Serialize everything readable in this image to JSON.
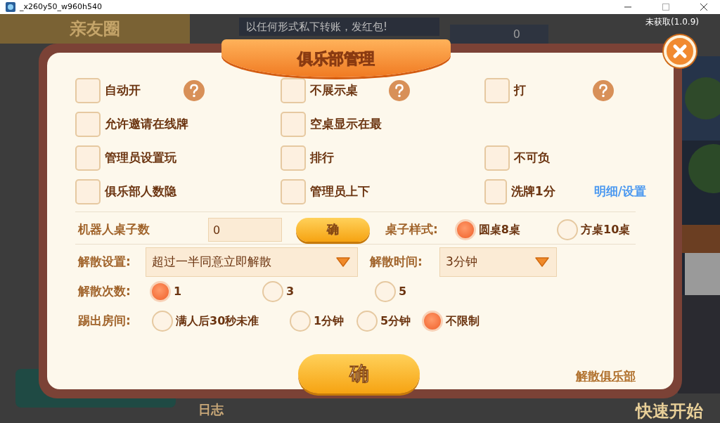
{
  "window": {
    "title": "_x260y50_w960h540"
  },
  "background": {
    "club_title": "亲友圈",
    "notice": "以任何形式私下转账，发红包!",
    "score": "0",
    "version": "未获取(1.0.9)",
    "log": "日志",
    "quick_start": "快速开始"
  },
  "dialog": {
    "title": "俱乐部管理",
    "option_rows": [
      [
        {
          "label": "自动开",
          "checked": false,
          "help": true
        },
        {
          "label": "不展示桌",
          "checked": false,
          "help": true
        },
        {
          "label": "打",
          "checked": false,
          "help": true
        }
      ],
      [
        {
          "label": "允许邀请在线牌",
          "checked": false,
          "help": false
        },
        {
          "label": "空桌显示在最",
          "checked": false,
          "help": false
        }
      ],
      [
        {
          "label": "管理员设置玩",
          "checked": false,
          "help": false
        },
        {
          "label": "排行",
          "checked": false,
          "help": false
        },
        {
          "label": "不可负",
          "checked": false,
          "help": false
        }
      ],
      [
        {
          "label": "俱乐部人数隐",
          "checked": false,
          "help": false
        },
        {
          "label": "管理员上下",
          "checked": false,
          "help": false
        },
        {
          "label": "洗牌1分",
          "checked": false,
          "help": false,
          "link": "明细/设置"
        }
      ]
    ],
    "robot": {
      "label": "机器人桌子数",
      "value": "0",
      "button": "确"
    },
    "table_style": {
      "label": "桌子样式:",
      "options": [
        {
          "label": "圆桌8桌",
          "selected": true
        },
        {
          "label": "方桌10桌",
          "selected": false
        }
      ]
    },
    "dissolve_setting": {
      "label": "解散设置:",
      "value": "超过一半同意立即解散"
    },
    "dissolve_time": {
      "label": "解散时间:",
      "value": "3分钟"
    },
    "dissolve_count": {
      "label": "解散次数:",
      "options": [
        {
          "label": "1",
          "selected": true
        },
        {
          "label": "3",
          "selected": false
        },
        {
          "label": "5",
          "selected": false
        }
      ]
    },
    "kick": {
      "label": "踢出房间:",
      "options": [
        {
          "label": "满人后30秒未准",
          "selected": false
        },
        {
          "label": "1分钟",
          "selected": false
        },
        {
          "label": "5分钟",
          "selected": false
        },
        {
          "label": "不限制",
          "selected": true
        }
      ]
    },
    "confirm": "确",
    "dissolve_club": "解散俱乐部"
  }
}
